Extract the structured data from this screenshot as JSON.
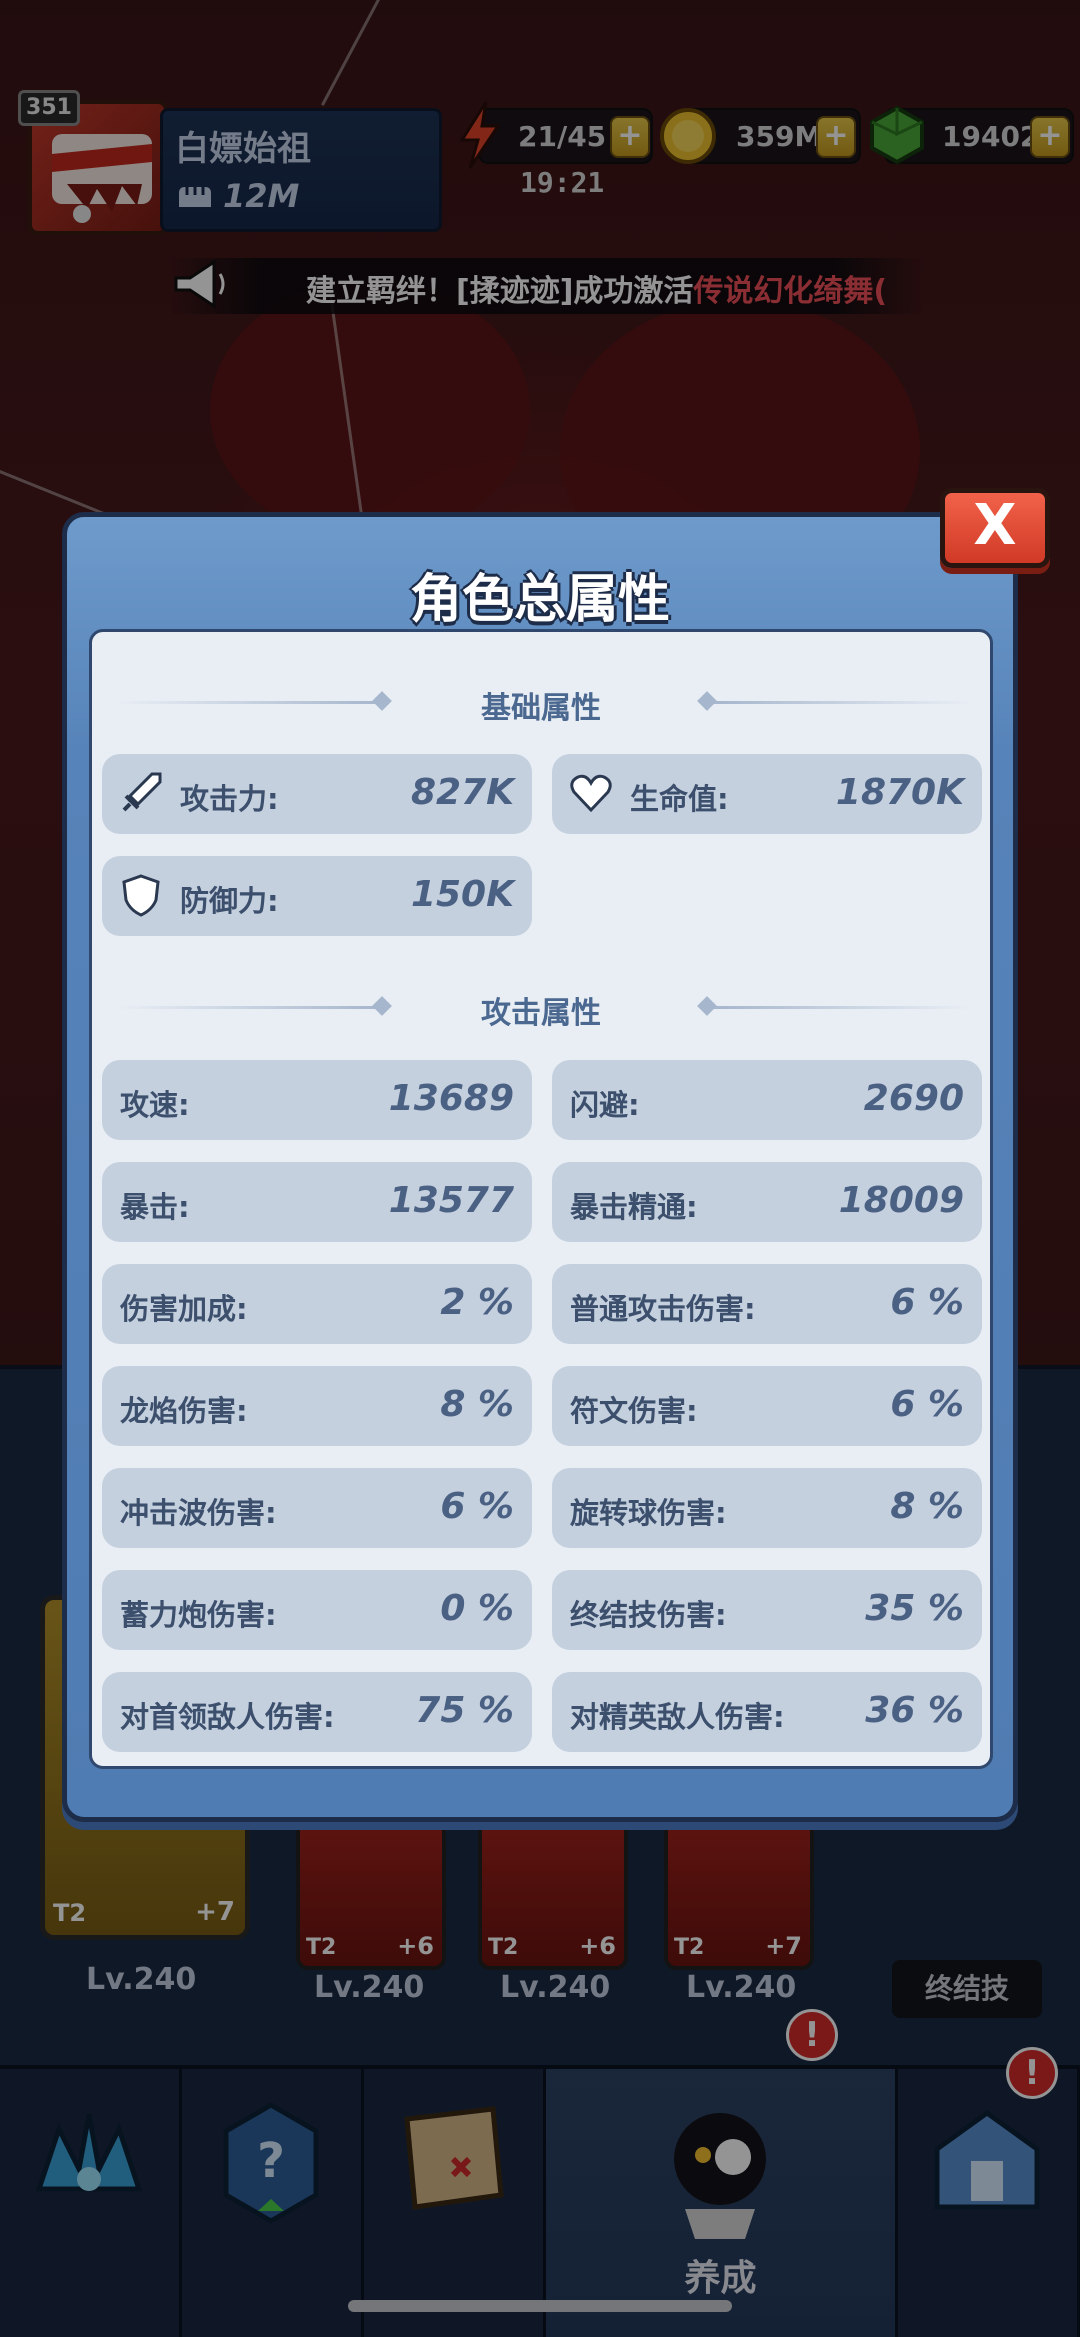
{
  "player": {
    "level": "351",
    "name": "白嫖始祖",
    "power": "12M"
  },
  "resources": {
    "energy": "21/45",
    "gold": "359M",
    "gems": "19402",
    "timer": "19:21"
  },
  "broadcast": {
    "prefix": "建立羁绊！[揉迹迹]成功激活",
    "highlight": "传说幻化绮舞("
  },
  "modal": {
    "title": "角色总属性",
    "close_label": "X",
    "sections": [
      {
        "title": "基础属性",
        "stats": [
          {
            "label": "攻击力:",
            "value": "827K",
            "icon": "sword-icon"
          },
          {
            "label": "生命值:",
            "value": "1870K",
            "icon": "heart-icon"
          },
          {
            "label": "防御力:",
            "value": "150K",
            "icon": "shield-icon"
          }
        ]
      },
      {
        "title": "攻击属性",
        "stats": [
          {
            "label": "攻速:",
            "value": "13689"
          },
          {
            "label": "闪避:",
            "value": "2690"
          },
          {
            "label": "暴击:",
            "value": "13577"
          },
          {
            "label": "暴击精通:",
            "value": "18009"
          },
          {
            "label": "伤害加成:",
            "value": "2 %"
          },
          {
            "label": "普通攻击伤害:",
            "value": "6 %"
          },
          {
            "label": "龙焰伤害:",
            "value": "8 %"
          },
          {
            "label": "符文伤害:",
            "value": "6 %"
          },
          {
            "label": "冲击波伤害:",
            "value": "6 %"
          },
          {
            "label": "旋转球伤害:",
            "value": "8 %"
          },
          {
            "label": "蓄力炮伤害:",
            "value": "0 %"
          },
          {
            "label": "终结技伤害:",
            "value": "35 %"
          },
          {
            "label": "对首领敌人伤害:",
            "value": "75 %"
          },
          {
            "label": "对精英敌人伤害:",
            "value": "36 %"
          }
        ]
      }
    ]
  },
  "equipment": [
    {
      "tier": "T2",
      "plus": "+7",
      "level": "Lv.240"
    },
    {
      "tier": "T2",
      "plus": "+6",
      "level": "Lv.240"
    },
    {
      "tier": "T2",
      "plus": "+6",
      "level": "Lv.240"
    },
    {
      "tier": "T2",
      "plus": "+7",
      "level": "Lv.240"
    }
  ],
  "finisher_label": "终结技",
  "nav": {
    "active_label": "养成",
    "alert": "!"
  },
  "colors": {
    "modal_blue": "#5683b9",
    "stat_value": "#4b6184",
    "close_red": "#d03a26",
    "broadcast_highlight": "#f0505a"
  }
}
